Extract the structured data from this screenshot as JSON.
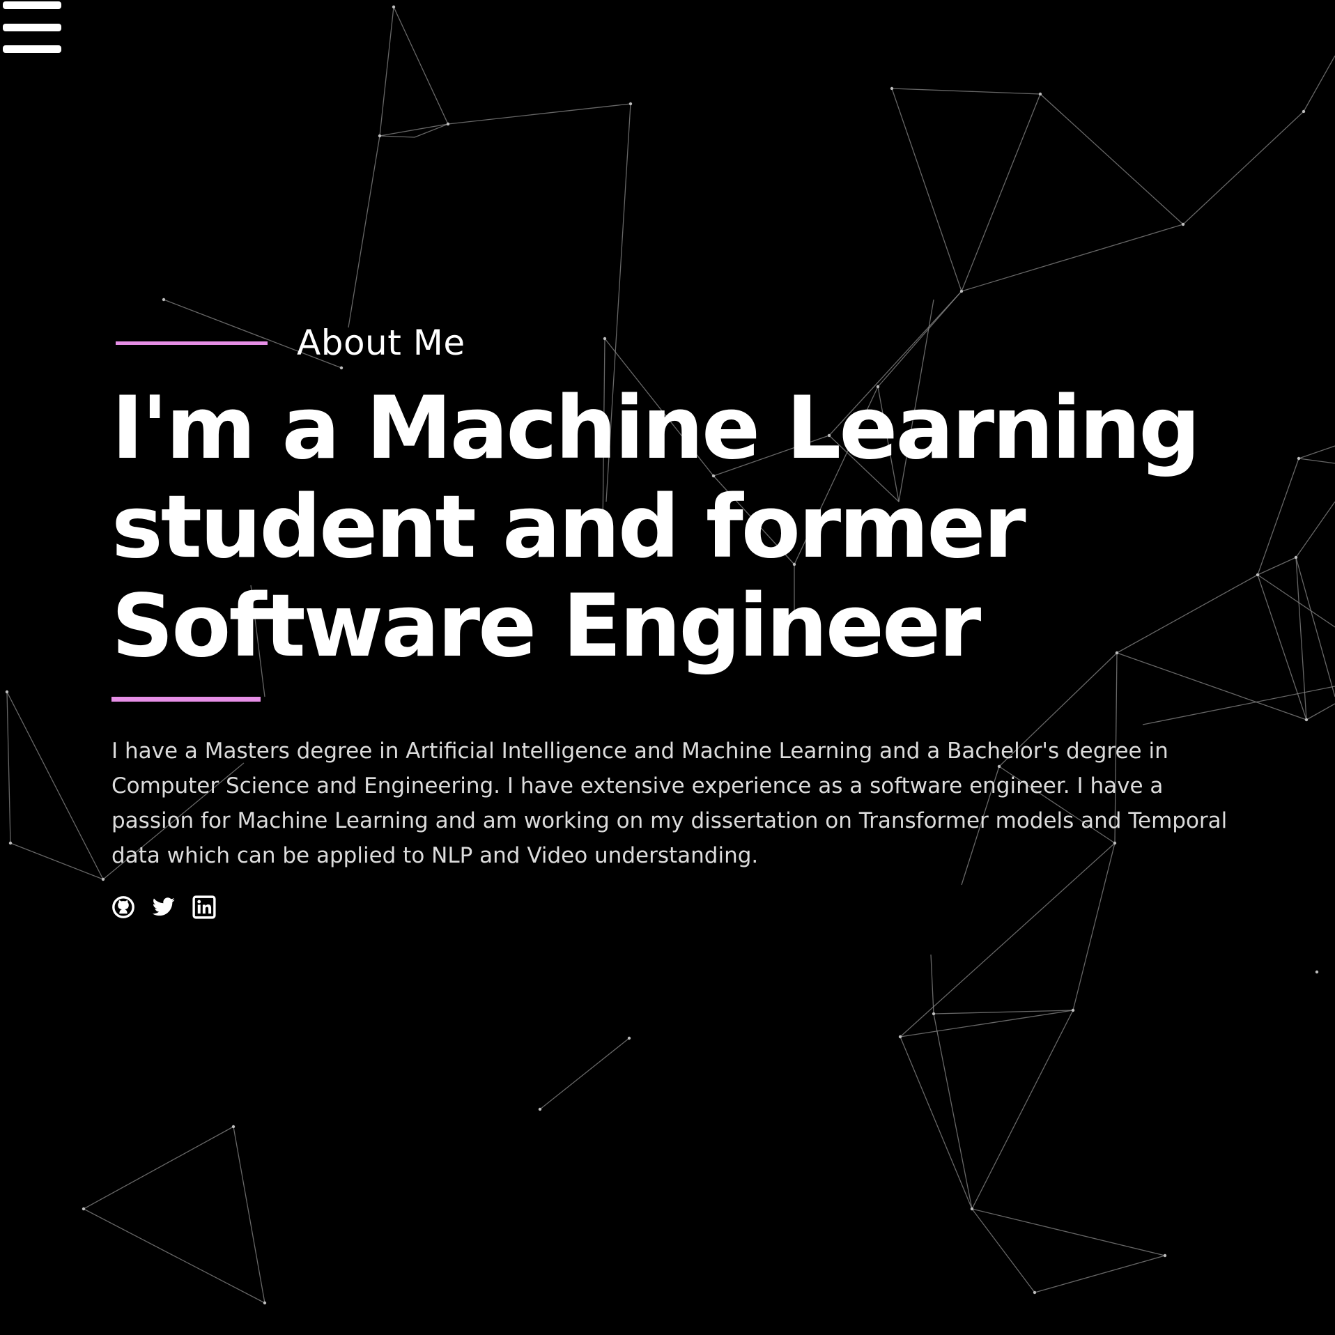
{
  "menu": {
    "icon": "hamburger-menu-icon"
  },
  "about": {
    "eyebrow": "About Me",
    "headline": "I'm a Machine Learning student and former Software Engineer",
    "bio": "I have a Masters degree in Artificial Intelligence and Machine Learning and a Bachelor's degree in Computer Science and Engineering. I have extensive experience as a software engineer. I have a passion for Machine Learning and am working on my dissertation on Transformer models and Temporal data which can be applied to NLP and Video understanding."
  },
  "socials": [
    {
      "icon": "github-icon"
    },
    {
      "icon": "twitter-icon"
    },
    {
      "icon": "linkedin-icon"
    }
  ],
  "colors": {
    "background": "#000000",
    "accent": "#e68fe6",
    "text": "#ffffff",
    "network_lines": "#8a8a8a"
  }
}
